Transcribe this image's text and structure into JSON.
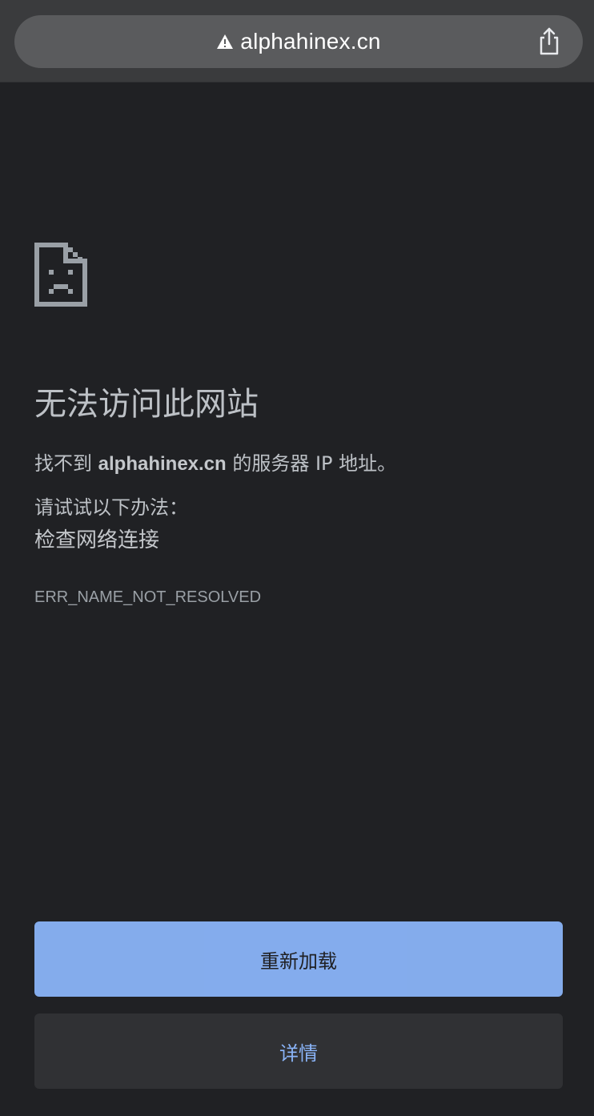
{
  "address_bar": {
    "warning_icon": "warning-triangle-icon",
    "url": "alphahinex.cn",
    "share_icon": "share-icon"
  },
  "error_page": {
    "icon": "sad-document-icon",
    "title": "无法访问此网站",
    "message_prefix": "找不到",
    "domain": "alphahinex.cn",
    "message_suffix": "的服务器 IP 地址。",
    "try_label": "请试试以下办法：",
    "suggestion": "检查网络连接",
    "error_code": "ERR_NAME_NOT_RESOLVED"
  },
  "buttons": {
    "reload_label": "重新加载",
    "details_label": "详情"
  },
  "colors": {
    "page_background": "#202124",
    "topbar": "#3a3b3d",
    "url_pill": "#5a5b5d",
    "primary_button": "#8ab4f8",
    "secondary_button": "#303134",
    "text": "#bdc1c6"
  }
}
